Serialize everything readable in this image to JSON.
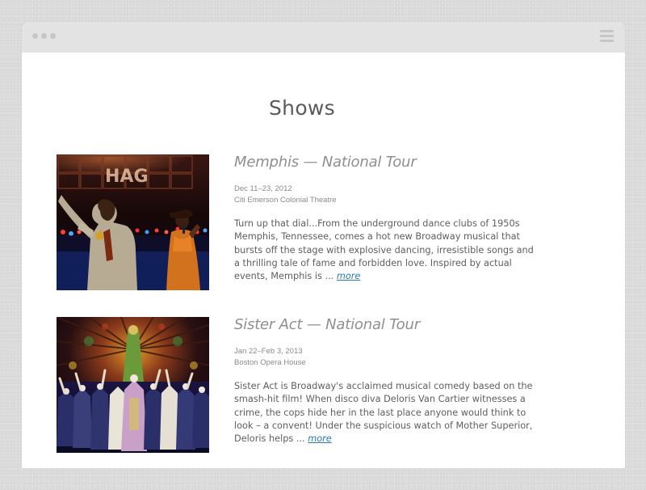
{
  "window": {
    "menu_icon": "hamburger-menu-icon"
  },
  "page": {
    "title": "Shows"
  },
  "shows": [
    {
      "title": "Memphis — National Tour",
      "dates": "Dec 11–23, 2012",
      "venue": "Citi Emerson Colonial Theatre",
      "description": "Turn up that dial...From the underground dance clubs of 1950s Memphis, Tennessee, comes a hot new Broadway musical that bursts off the stage with explosive dancing, irresistible songs and a thrilling tale of fame and forbidden love. Inspired by actual events, Memphis is ...",
      "more_label": "more",
      "image_label": "HAG"
    },
    {
      "title": "Sister Act — National Tour",
      "dates": "Jan 22–Feb 3, 2013",
      "venue": "Boston Opera House",
      "description": "Sister Act is Broadway's acclaimed musical comedy based on the smash-hit film! When disco diva Deloris Van Cartier witnesses a crime, the cops hide her in the last place anyone would think to look – a convent! Under the suspicious watch of Mother Superior, Deloris helps ...",
      "more_label": "more"
    }
  ],
  "colors": {
    "link": "#2a7bb5",
    "titlebar": "#e3e3e3",
    "background": "#dcdcdc"
  }
}
